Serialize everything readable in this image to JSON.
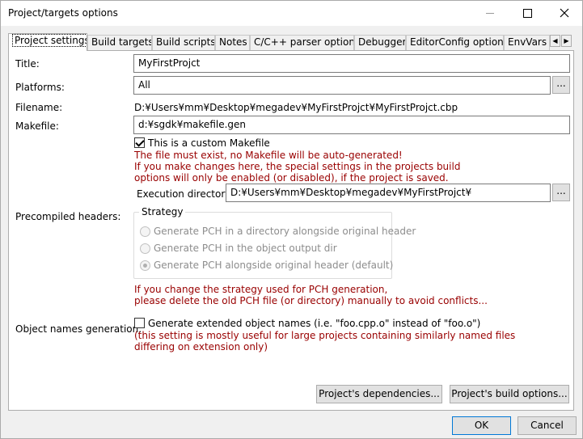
{
  "window": {
    "title": "Project/targets options"
  },
  "tabs": [
    {
      "label": "Project settings"
    },
    {
      "label": "Build targets"
    },
    {
      "label": "Build scripts"
    },
    {
      "label": "Notes"
    },
    {
      "label": "C/C++ parser options"
    },
    {
      "label": "Debugger"
    },
    {
      "label": "EditorConfig options"
    },
    {
      "label": "EnvVars"
    }
  ],
  "form": {
    "title_label": "Title:",
    "title_value": "MyFirstProjct",
    "platforms_label": "Platforms:",
    "platforms_value": "All",
    "browse_label": "...",
    "filename_label": "Filename:",
    "filename_value": "D:¥Users¥mm¥Desktop¥megadev¥MyFirstProjct¥MyFirstProjct.cbp",
    "makefile_label": "Makefile:",
    "makefile_value": "d:¥sgdk¥makefile.gen",
    "custom_makefile_label": "This is a custom Makefile",
    "custom_makefile_checked": true,
    "makefile_note_1": "The file must exist, no Makefile will be auto-generated!",
    "makefile_note_2": "If you make changes here, the special settings in the projects build",
    "makefile_note_3": "options will only be enabled (or disabled), if the project is saved.",
    "exec_dir_label": "Execution directory:",
    "exec_dir_value": "D:¥Users¥mm¥Desktop¥megadev¥MyFirstProjct¥",
    "pch_label": "Precompiled headers:",
    "strategy_legend": "Strategy",
    "pch_options": [
      "Generate PCH in a directory alongside original header",
      "Generate PCH in the object output dir",
      "Generate PCH alongside original header (default)"
    ],
    "pch_note_1": "If you change the strategy used for PCH generation,",
    "pch_note_2": "please delete the old PCH file (or directory) manually to avoid conflicts...",
    "objnames_label": "Object names generation:",
    "objnames_check_label": "Generate extended object names (i.e. \"foo.cpp.o\" instead of \"foo.o\")",
    "objnames_note_1": "(this setting is mostly useful for large projects containing similarly named files",
    "objnames_note_2": "differing on extension only)",
    "deps_button": "Project's dependencies...",
    "build_opts_button": "Project's build options..."
  },
  "footer": {
    "ok": "OK",
    "cancel": "Cancel"
  }
}
